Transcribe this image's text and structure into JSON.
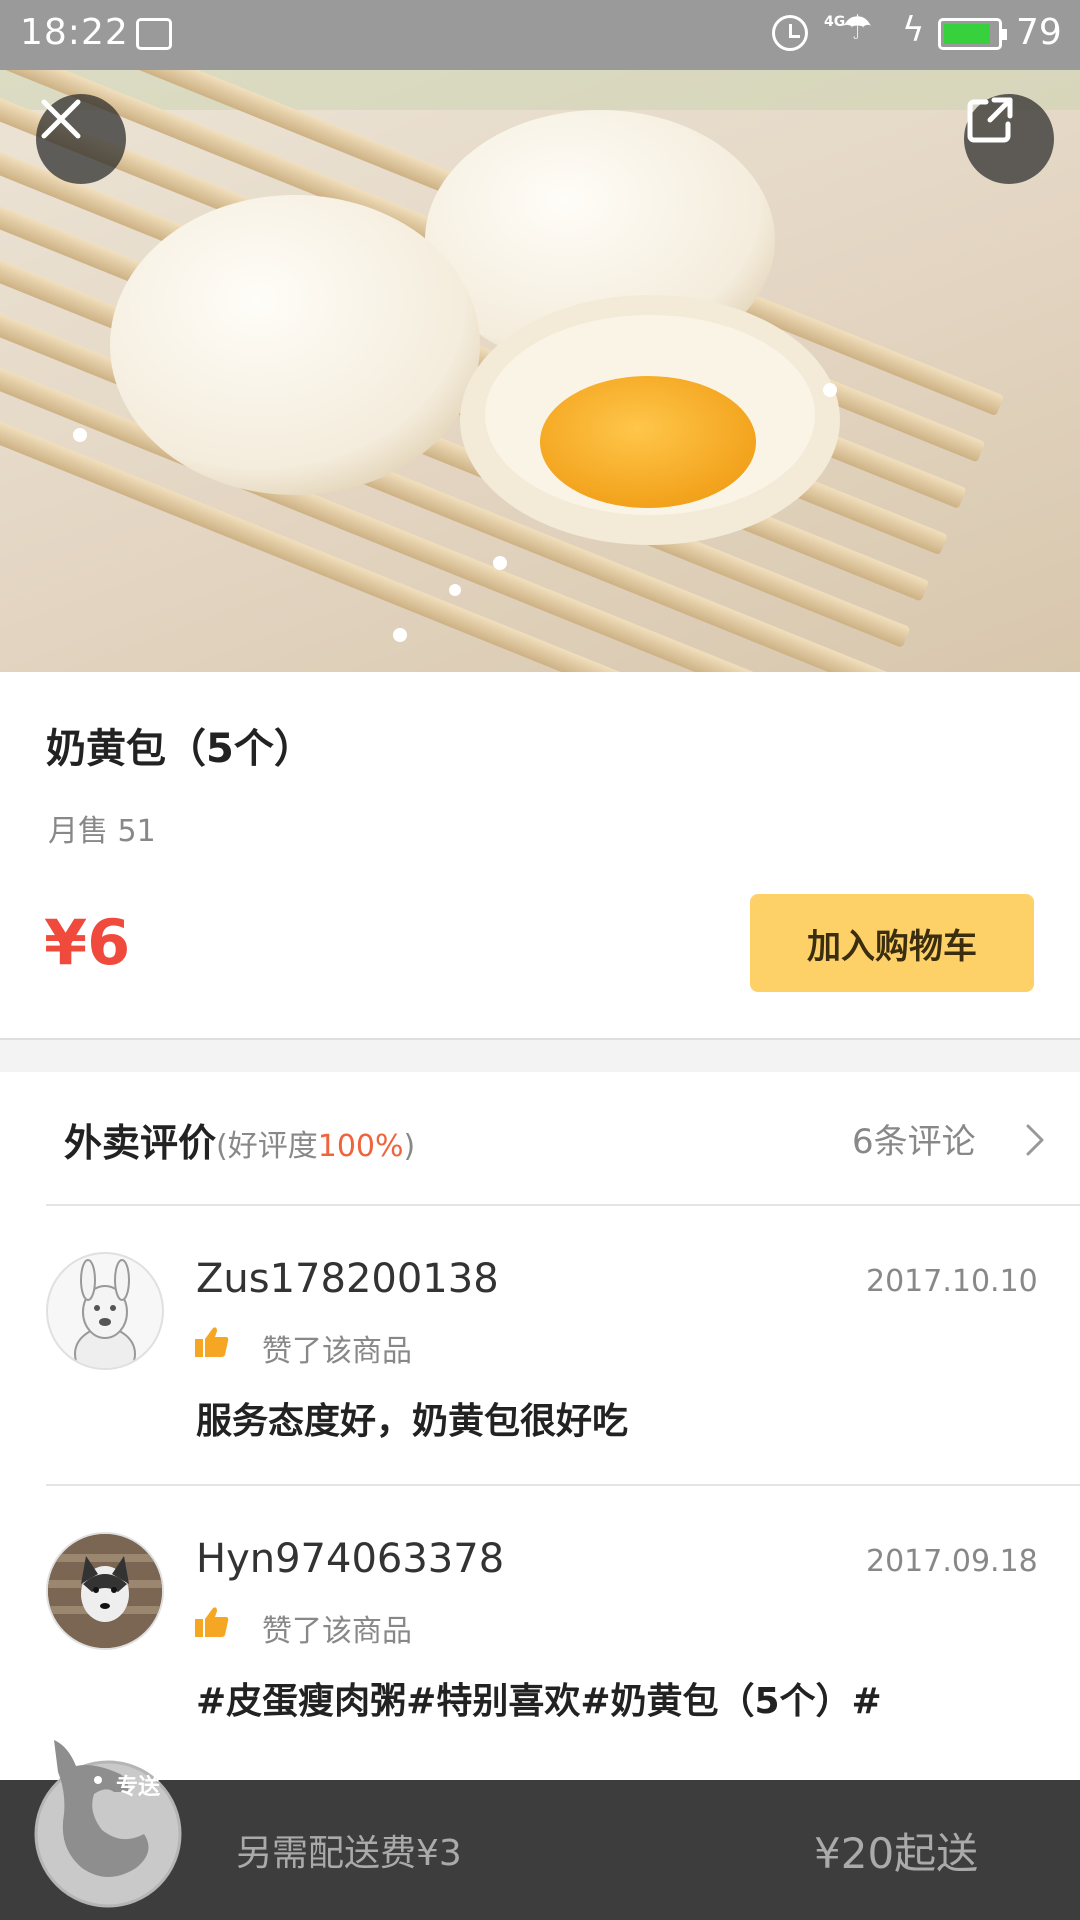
{
  "status_bar": {
    "time": "18:22",
    "network": "4G",
    "battery": "79"
  },
  "product": {
    "name": "奶黄包（5个）",
    "sales": "月售 51",
    "price": "¥6",
    "add_to_cart": "加入购物车"
  },
  "reviews": {
    "title": "外卖评价",
    "rating_prefix": "(好评度",
    "rating_value": "100%",
    "rating_suffix": ")",
    "count": "6条评论",
    "items": [
      {
        "user": "Zus178200138",
        "date": "2017.10.10",
        "liked": "赞了该商品",
        "text": "服务态度好，奶黄包很好吃"
      },
      {
        "user": "Hyn974063378",
        "date": "2017.09.18",
        "liked": "赞了该商品",
        "text": "#皮蛋瘦肉粥#特别喜欢#奶黄包（5个）#"
      }
    ]
  },
  "bottom_bar": {
    "logo_text": "专送",
    "delivery_fee": "另需配送费¥3",
    "minimum": "¥20起送"
  },
  "colors": {
    "price": "#f04a3c",
    "add_cart_bg": "#fdd168",
    "rating_highlight": "#f0643c",
    "bottom_bar": "#3d3d3d",
    "thumb_icon": "#f5a623"
  },
  "icons": [
    "close-icon",
    "share-icon",
    "chevron-right-icon",
    "thumbs-up-icon",
    "kangaroo-logo-icon",
    "alarm-icon",
    "battery-icon"
  ]
}
